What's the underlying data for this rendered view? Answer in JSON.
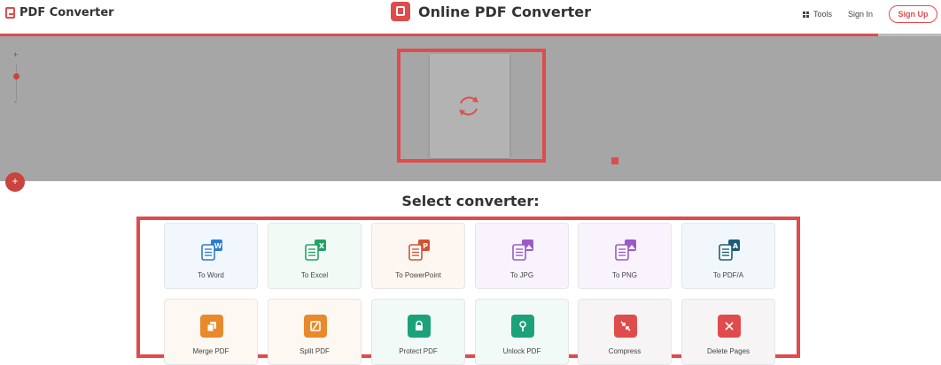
{
  "header": {
    "brand": "PDF Converter",
    "center_title": "Online PDF Converter",
    "tools_label": "Tools",
    "signin_label": "Sign In",
    "signup_label": "Sign Up",
    "progress": 0.933
  },
  "viewer": {
    "zoom_in": "+",
    "zoom_out": "-",
    "spinner_icon": "refresh-icon"
  },
  "converter": {
    "title": "Select converter:",
    "items": [
      {
        "label": "To Word",
        "icon": "word-doc-icon",
        "letter": "W",
        "color": "#2b7cd3",
        "bg": "#f1f7fd"
      },
      {
        "label": "To Excel",
        "icon": "excel-doc-icon",
        "letter": "X",
        "color": "#21a366",
        "bg": "#f2faf5"
      },
      {
        "label": "To PowerPoint",
        "icon": "powerpoint-doc-icon",
        "letter": "P",
        "color": "#d35230",
        "bg": "#fdf6f1"
      },
      {
        "label": "To JPG",
        "icon": "jpg-doc-icon",
        "letter": "",
        "color": "#9b59c9",
        "bg": "#f8f3fc"
      },
      {
        "label": "To PNG",
        "icon": "png-doc-icon",
        "letter": "",
        "color": "#9b59c9",
        "bg": "#f8f3fc"
      },
      {
        "label": "To PDF/A",
        "icon": "pdfa-doc-icon",
        "letter": "A",
        "color": "#1a5d7a",
        "bg": "#f1f7fa"
      },
      {
        "label": "Merge PDF",
        "icon": "merge-icon",
        "color": "#e8892b",
        "bg": "#fdf8f2"
      },
      {
        "label": "Split PDF",
        "icon": "split-icon",
        "color": "#e8892b",
        "bg": "#fdf8f2"
      },
      {
        "label": "Protect PDF",
        "icon": "lock-icon",
        "color": "#1ba27a",
        "bg": "#f2faf7"
      },
      {
        "label": "Unlock PDF",
        "icon": "unlock-icon",
        "color": "#1ba27a",
        "bg": "#f2faf7"
      },
      {
        "label": "Compress",
        "icon": "compress-icon",
        "color": "#e04b4b",
        "bg": "#f6f4f4"
      },
      {
        "label": "Delete Pages",
        "icon": "delete-icon",
        "color": "#e04b4b",
        "bg": "#f6f4f4"
      }
    ]
  },
  "colors": {
    "accent": "#e04b4b",
    "viewer_bg": "#a6a6a6"
  }
}
